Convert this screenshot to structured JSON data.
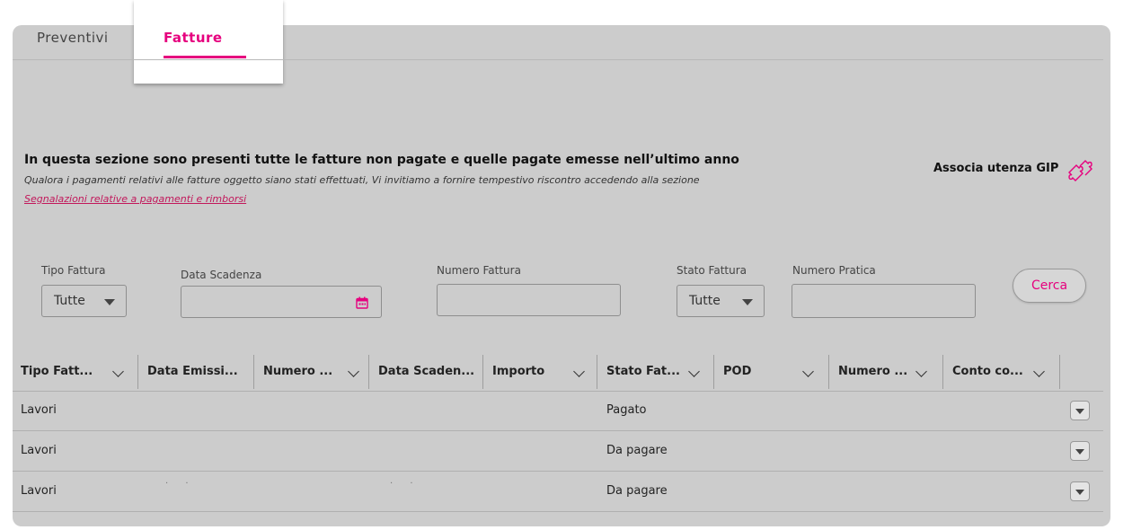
{
  "tabs": [
    {
      "label": "Preventivi",
      "active": false
    },
    {
      "label": "Fatture",
      "active": true
    }
  ],
  "info": {
    "title": "In questa sezione sono presenti tutte le fatture non pagate e quelle pagate emesse nell’ultimo anno",
    "subtitle": "Qualora i pagamenti relativi alle fatture oggetto siano stati effettuati, Vi invitiamo a fornire tempestivo riscontro accedendo alla sezione",
    "link": "Segnalazioni relative a pagamenti e rimborsi"
  },
  "gip": {
    "label": "Associa utenza GIP",
    "icon": "puzzle-icon"
  },
  "filters": {
    "tipo_fattura": {
      "label": "Tipo Fattura",
      "value": "Tutte"
    },
    "data_scadenza": {
      "label": "Data Scadenza",
      "value": "",
      "icon": "calendar-icon"
    },
    "numero_fattura": {
      "label": "Numero Fattura",
      "value": ""
    },
    "stato_fattura": {
      "label": "Stato Fattura",
      "value": "Tutte"
    },
    "numero_pratica": {
      "label": "Numero Pratica",
      "value": ""
    },
    "search_label": "Cerca"
  },
  "table": {
    "columns": [
      "Tipo Fatt...",
      "Data Emissi...",
      "Numero ...",
      "Data Scaden...",
      "Importo",
      "Stato Fat...",
      "POD",
      "Numero ...",
      "Conto co..."
    ],
    "rows": [
      {
        "tipo": "Lavori",
        "stato": "Pagato"
      },
      {
        "tipo": "Lavori",
        "stato": "Da pagare"
      },
      {
        "tipo": "Lavori",
        "stato": "Da pagare"
      }
    ]
  },
  "colors": {
    "accent": "#e6007e",
    "panel": "#cccccc"
  }
}
